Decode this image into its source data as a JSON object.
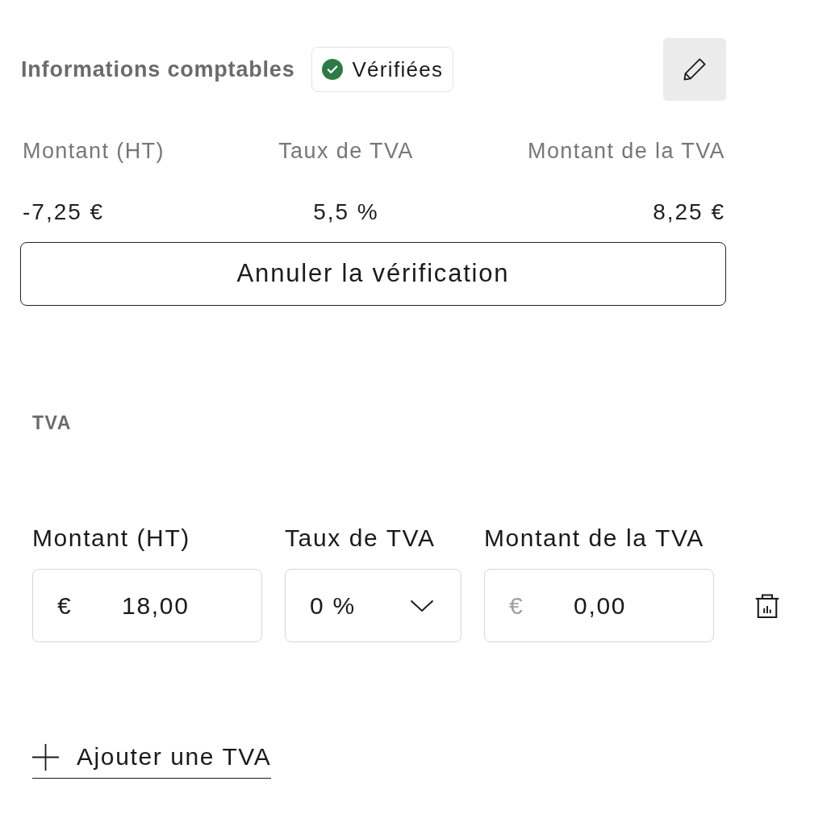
{
  "accounting_info": {
    "title": "Informations comptables",
    "status_badge": {
      "label": "Vérifiées"
    },
    "summary": [
      {
        "label": "Montant (HT)",
        "value": "-7,25 €"
      },
      {
        "label": "Taux de TVA",
        "value": "5,5 %"
      },
      {
        "label": "Montant de la TVA",
        "value": "8,25 €"
      }
    ],
    "cancel_button": {
      "label": "Annuler la vérification"
    }
  },
  "vat": {
    "title": "TVA",
    "fields": [
      {
        "kind": "amount",
        "label": "Montant (HT)",
        "currency": "€",
        "value": "18,00",
        "disabled": false
      },
      {
        "kind": "select",
        "label": "Taux de TVA",
        "value": "0 %"
      },
      {
        "kind": "amount",
        "label": "Montant de la TVA",
        "currency": "€",
        "value": "0,00",
        "disabled": true
      }
    ],
    "add_button": {
      "label": "Ajouter une TVA"
    }
  }
}
